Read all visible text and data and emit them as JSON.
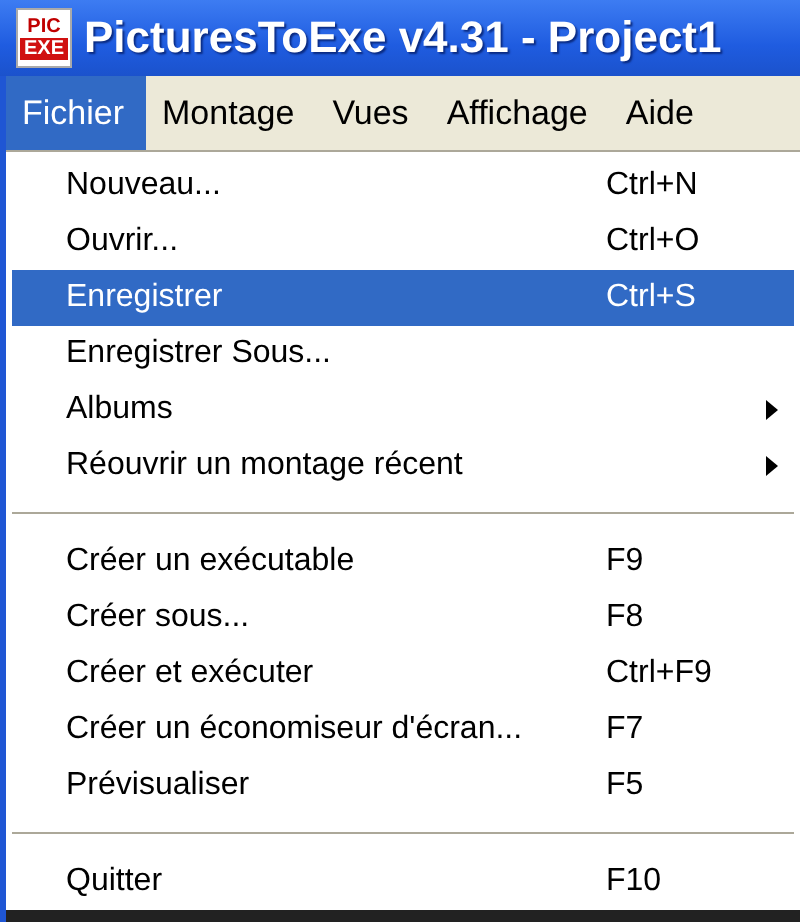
{
  "window": {
    "title": "PicturesToExe v4.31 - Project1",
    "app_icon": {
      "top": "PIC",
      "bottom": "EXE"
    }
  },
  "menubar": [
    {
      "label": "Fichier",
      "selected": true
    },
    {
      "label": "Montage",
      "selected": false
    },
    {
      "label": "Vues",
      "selected": false
    },
    {
      "label": "Affichage",
      "selected": false
    },
    {
      "label": "Aide",
      "selected": false
    }
  ],
  "menu": [
    {
      "kind": "item",
      "label": "Nouveau...",
      "shortcut": "Ctrl+N",
      "selected": false,
      "submenu": false
    },
    {
      "kind": "item",
      "label": "Ouvrir...",
      "shortcut": "Ctrl+O",
      "selected": false,
      "submenu": false
    },
    {
      "kind": "item",
      "label": "Enregistrer",
      "shortcut": "Ctrl+S",
      "selected": true,
      "submenu": false
    },
    {
      "kind": "item",
      "label": "Enregistrer Sous...",
      "selected": false,
      "submenu": false
    },
    {
      "kind": "item",
      "label": "Albums",
      "selected": false,
      "submenu": true
    },
    {
      "kind": "item",
      "label": "Réouvrir un montage récent",
      "selected": false,
      "submenu": true
    },
    {
      "kind": "separator"
    },
    {
      "kind": "item",
      "label": "Créer un exécutable",
      "shortcut": "F9",
      "selected": false,
      "submenu": false
    },
    {
      "kind": "item",
      "label": "Créer sous...",
      "shortcut": "F8",
      "selected": false,
      "submenu": false
    },
    {
      "kind": "item",
      "label": "Créer et exécuter",
      "shortcut": "Ctrl+F9",
      "selected": false,
      "submenu": false
    },
    {
      "kind": "item",
      "label": "Créer un économiseur d'écran...",
      "shortcut": "F7",
      "selected": false,
      "submenu": false
    },
    {
      "kind": "item",
      "label": "Prévisualiser",
      "shortcut": "F5",
      "selected": false,
      "submenu": false
    },
    {
      "kind": "separator"
    },
    {
      "kind": "item",
      "label": "Quitter",
      "shortcut": "F10",
      "selected": false,
      "submenu": false
    }
  ]
}
